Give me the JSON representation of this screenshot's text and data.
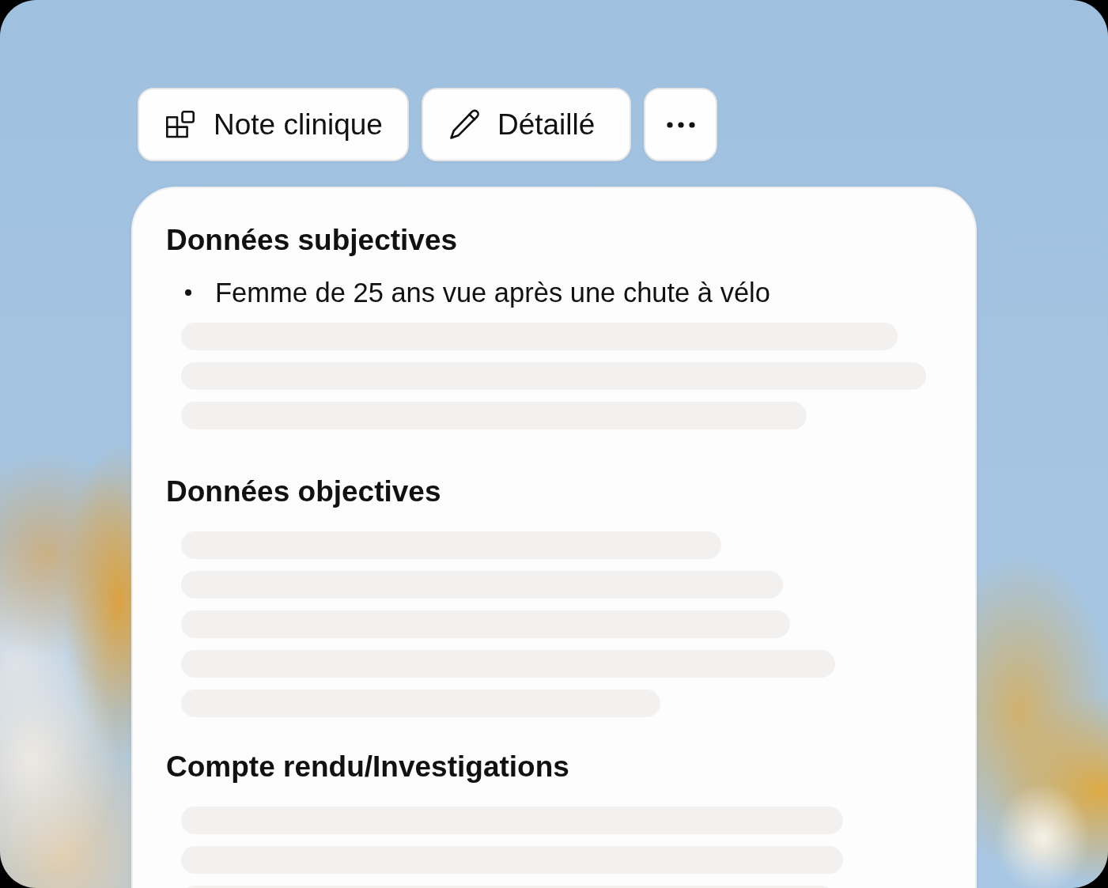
{
  "toolbar": {
    "buttons": [
      {
        "kind": "template",
        "label": "Note clinique"
      },
      {
        "kind": "detail",
        "label": "Détaillé"
      },
      {
        "kind": "more"
      }
    ]
  },
  "note": {
    "sections": [
      {
        "title": "Données subjectives",
        "items": [
          {
            "kind": "bullet",
            "text": "Femme de 25 ans vue après une chute à vélo"
          },
          {
            "kind": "skeleton"
          },
          {
            "kind": "skeleton"
          },
          {
            "kind": "skeleton"
          }
        ]
      },
      {
        "title": "Données objectives",
        "items": [
          {
            "kind": "skeleton"
          },
          {
            "kind": "skeleton"
          },
          {
            "kind": "skeleton"
          },
          {
            "kind": "skeleton"
          },
          {
            "kind": "skeleton"
          }
        ]
      },
      {
        "title": "Compte rendu/Investigations",
        "items": [
          {
            "kind": "skeleton"
          },
          {
            "kind": "skeleton"
          },
          {
            "kind": "skeleton"
          }
        ]
      }
    ]
  }
}
